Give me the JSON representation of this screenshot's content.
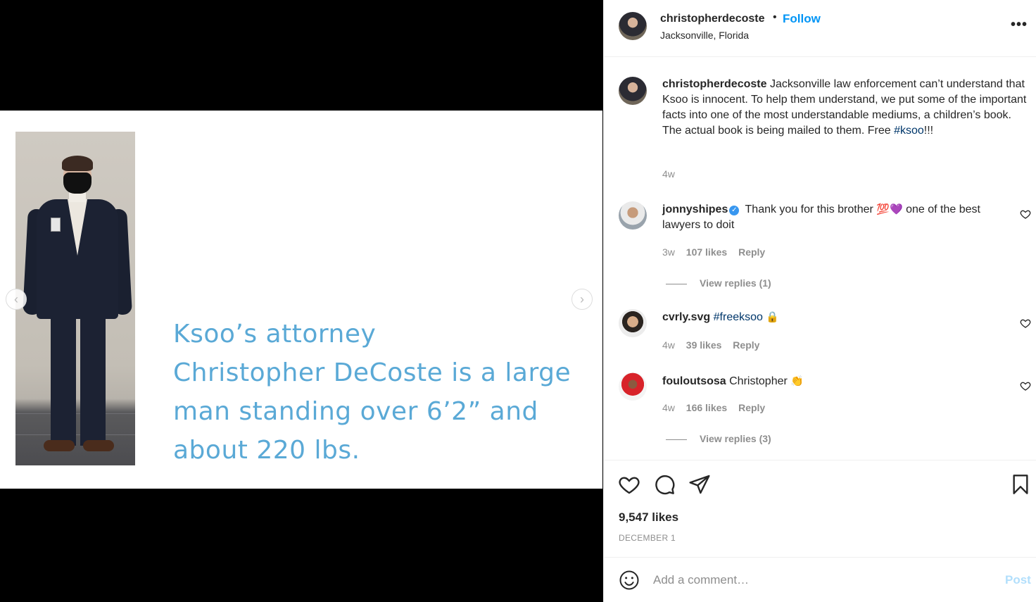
{
  "post": {
    "username": "christopherdecoste",
    "follow_label": "Follow",
    "separator": "•",
    "location": "Jacksonville, Florida",
    "more_label": "•••"
  },
  "media": {
    "caption_lines": [
      "Ksoo’s attorney",
      "Christopher DeCoste is a large",
      "man standing over 6’2” and",
      "about 220 lbs."
    ],
    "prev_label": "‹",
    "next_label": "›"
  },
  "caption": {
    "username": "christopherdecoste",
    "text": "Jacksonville law enforcement can’t understand that Ksoo is innocent. To help them understand, we put some of the important facts into one of the most understandable mediums, a children’s book. The actual book is being mailed to them. Free ",
    "hashtag": "#ksoo",
    "text_end": "!!!",
    "age": "4w"
  },
  "comments": [
    {
      "username": "jonnyshipes",
      "verified": true,
      "text_a": "Thank you for this brother ",
      "emoji_a": "💯",
      "emoji_b": "💜",
      "text_b": " one of the best lawyers to doit",
      "age": "3w",
      "likes": "107 likes",
      "reply": "Reply",
      "view_replies": "View replies (1)"
    },
    {
      "username": "cvrly.svg",
      "hashtag": "#freeksoo",
      "emoji": "🔒",
      "age": "4w",
      "likes": "39 likes",
      "reply": "Reply"
    },
    {
      "username": "fouloutsosa",
      "text": "Christopher ",
      "emoji": "👏",
      "age": "4w",
      "likes": "166 likes",
      "reply": "Reply",
      "view_replies": "View replies (3)"
    }
  ],
  "footer": {
    "likes": "9,547 likes",
    "date": "DECEMBER 1",
    "comment_placeholder": "Add a comment…",
    "post_label": "Post"
  },
  "colors": {
    "accent": "#0095f6",
    "caption_art": "#5aa9d6",
    "hashtag": "#00376b",
    "muted": "#8e8e8e",
    "post_disabled": "#b2dffc"
  }
}
